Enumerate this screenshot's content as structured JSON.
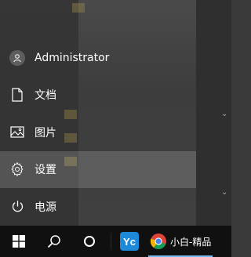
{
  "start_menu": {
    "user": {
      "label": "Administrator",
      "icon": "user-avatar-icon"
    },
    "items": [
      {
        "label": "文档",
        "icon": "document-icon"
      },
      {
        "label": "图片",
        "icon": "pictures-icon"
      },
      {
        "label": "设置",
        "icon": "gear-icon"
      },
      {
        "label": "电源",
        "icon": "power-icon"
      }
    ]
  },
  "taskbar": {
    "start_icon": "windows-logo-icon",
    "search_icon": "search-icon",
    "cortana_icon": "cortana-icon",
    "app1": {
      "label": "Yc",
      "color": "#1d8ad9"
    },
    "app2": {
      "icon": "chrome-icon",
      "title": "小白-精品"
    }
  },
  "colors": {
    "taskbar_bg": "#101010",
    "accent": "#76b9ed"
  }
}
